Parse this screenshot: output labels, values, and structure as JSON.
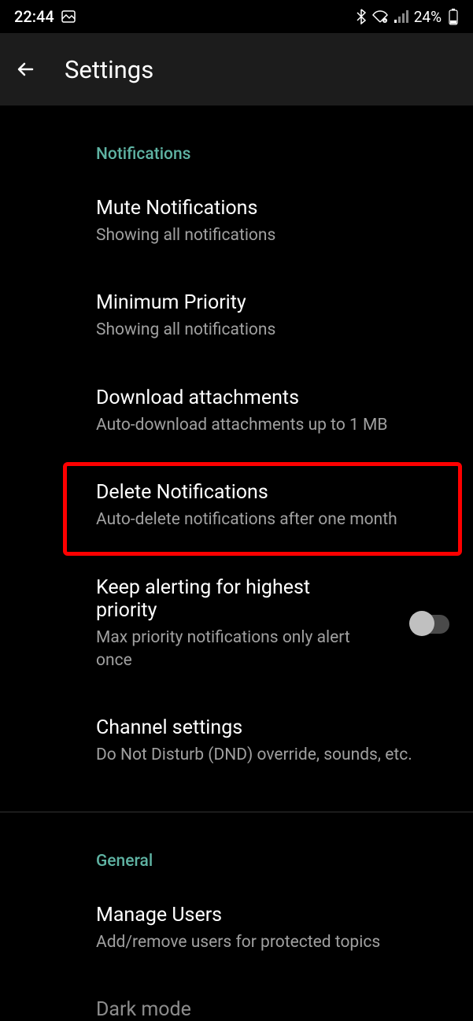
{
  "statusBar": {
    "time": "22:44",
    "battery": "24%"
  },
  "header": {
    "title": "Settings"
  },
  "sections": {
    "notifications": {
      "header": "Notifications",
      "items": {
        "mute": {
          "title": "Mute Notifications",
          "subtitle": "Showing all notifications"
        },
        "priority": {
          "title": "Minimum Priority",
          "subtitle": "Showing all notifications"
        },
        "download": {
          "title": "Download attachments",
          "subtitle": "Auto-download attachments up to 1 MB"
        },
        "delete": {
          "title": "Delete Notifications",
          "subtitle": "Auto-delete notifications after one month"
        },
        "keepAlerting": {
          "title": "Keep alerting for highest priority",
          "subtitle": "Max priority notifications only alert once"
        },
        "channel": {
          "title": "Channel settings",
          "subtitle": "Do Not Disturb (DND) override, sounds, etc."
        }
      }
    },
    "general": {
      "header": "General",
      "items": {
        "manageUsers": {
          "title": "Manage Users",
          "subtitle": "Add/remove users for protected topics"
        },
        "darkMode": {
          "title": "Dark mode"
        }
      }
    }
  }
}
